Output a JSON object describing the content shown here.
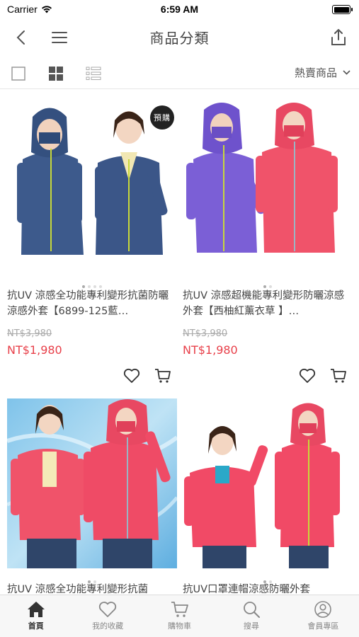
{
  "status_bar": {
    "carrier": "Carrier",
    "time": "6:59 AM"
  },
  "nav": {
    "title": "商品分類",
    "icons": [
      "back-icon",
      "menu-icon",
      "share-icon"
    ]
  },
  "toolbar": {
    "sort_label": "熱賣商品",
    "view_modes": [
      "single-view-icon",
      "grid-view-icon",
      "list-view-icon"
    ],
    "active_view": "grid"
  },
  "products": [
    {
      "name": "抗UV 涼感全功能專利變形抗菌防曬涼感外套【6899-125藍…",
      "original_price": "NT$3,980",
      "sale_price": "NT$1,980",
      "badge": "預購",
      "color": "#3d5a8c"
    },
    {
      "name": "抗UV 涼感超機能專利變形防曬涼感外套【西柚紅薰衣草 】…",
      "original_price": "NT$3,980",
      "sale_price": "NT$1,980",
      "color": "#7b5fd6"
    },
    {
      "name": "抗UV 涼感全功能專利變形抗菌",
      "color": "#f0536a"
    },
    {
      "name": "抗UV口罩連帽涼感防曬外套",
      "color": "#f14a66"
    }
  ],
  "tabs": [
    {
      "label": "首頁",
      "icon": "home-icon",
      "active": true
    },
    {
      "label": "我的收藏",
      "icon": "heart-icon",
      "active": false
    },
    {
      "label": "購物車",
      "icon": "cart-icon",
      "active": false
    },
    {
      "label": "搜尋",
      "icon": "search-icon",
      "active": false
    },
    {
      "label": "會員專區",
      "icon": "user-icon",
      "active": false
    }
  ],
  "colors": {
    "accent_price": "#e8404a",
    "tab_active": "#333333",
    "tab_inactive": "#888888"
  }
}
